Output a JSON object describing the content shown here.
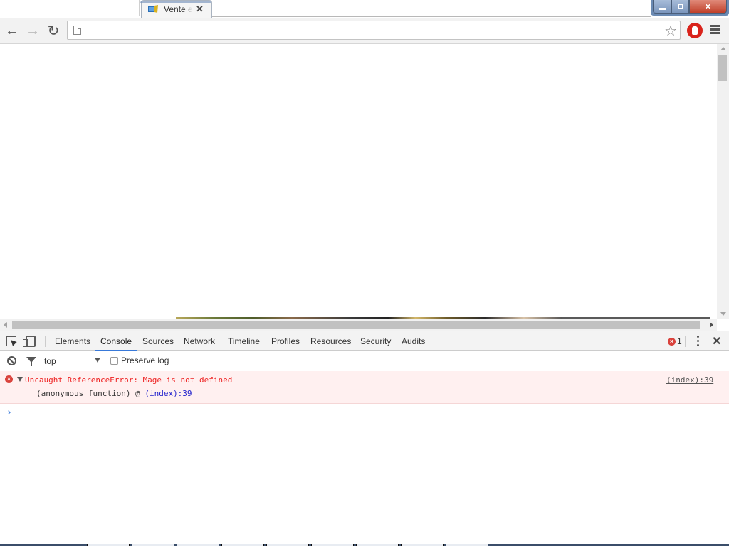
{
  "browser": {
    "tabs": [
      {
        "title": "Vente e",
        "active": true,
        "favicon": "site-favicon"
      }
    ],
    "window_controls": {
      "minimize": "minimize",
      "maximize": "restore",
      "close": "close"
    },
    "toolbar": {
      "back_icon": "←",
      "forward_icon": "→",
      "reload_icon": "↻",
      "address": "",
      "star_icon": "☆"
    }
  },
  "devtools": {
    "tabs": [
      {
        "label": "Elements",
        "active": false
      },
      {
        "label": "Console",
        "active": true
      },
      {
        "label": "Sources",
        "active": false
      },
      {
        "label": "Network",
        "active": false
      },
      {
        "label": "Timeline",
        "active": false
      },
      {
        "label": "Profiles",
        "active": false
      },
      {
        "label": "Resources",
        "active": false
      },
      {
        "label": "Security",
        "active": false
      },
      {
        "label": "Audits",
        "active": false
      }
    ],
    "error_count": "1",
    "error_icon": "×",
    "close_icon": "✕",
    "console_toolbar": {
      "context": "top",
      "preserve_log_label": "Preserve log",
      "preserve_log_checked": false
    },
    "messages": [
      {
        "level": "error",
        "text": "Uncaught ReferenceError: Mage is not defined",
        "stack_prefix": "(anonymous function) @ ",
        "stack_link": "(index):39",
        "source": "(index):39"
      }
    ],
    "prompt_chevron": "›",
    "prompt_value": ""
  },
  "colors": {
    "error_text": "#ee2222",
    "error_bg": "#fff0f0",
    "active_tab_underline": "#3879d9",
    "adblock_red": "#d9231b"
  }
}
